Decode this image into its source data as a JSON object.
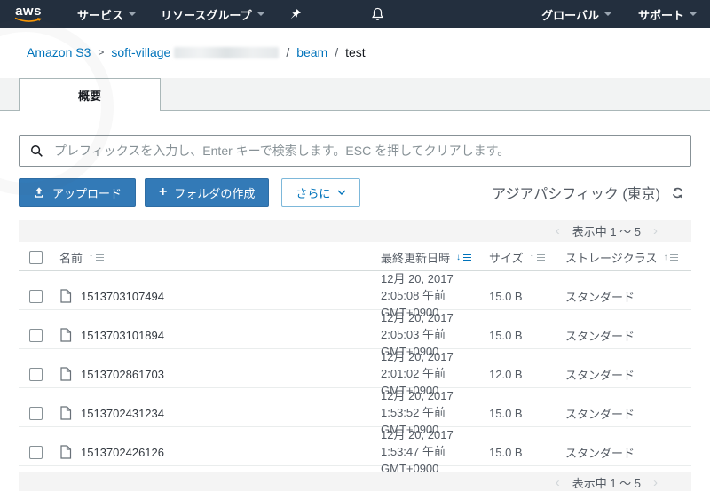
{
  "colors": {
    "nav_bg": "#232f3e",
    "accent_blue": "#0073bb",
    "button_blue": "#337ab7",
    "logo_orange": "#ff9900"
  },
  "topnav": {
    "logo_text": "aws",
    "services_label": "サービス",
    "resource_groups_label": "リソースグループ",
    "global_label": "グローバル",
    "support_label": "サポート"
  },
  "breadcrumb": {
    "root": "Amazon S3",
    "root_separator": ">",
    "bucket_visible": "soft-village",
    "path_separator": "/",
    "folder": "beam",
    "current": "test"
  },
  "tabs": {
    "overview_label": "概要"
  },
  "search": {
    "placeholder": "プレフィックスを入力し、Enter キーで検索します。ESC を押してクリアします。"
  },
  "toolbar": {
    "upload_label": "アップロード",
    "create_folder_label": "フォルダの作成",
    "more_label": "さらに",
    "region_label": "アジアパシフィック (東京)"
  },
  "table": {
    "pagination_label": "表示中 1 ～ 5",
    "columns": [
      {
        "label": "名前",
        "sort_active": false,
        "sort_dir": "asc"
      },
      {
        "label": "最終更新日時",
        "sort_active": true,
        "sort_dir": "desc"
      },
      {
        "label": "サイズ",
        "sort_active": false,
        "sort_dir": "asc"
      },
      {
        "label": "ストレージクラス",
        "sort_active": false,
        "sort_dir": "asc"
      }
    ],
    "rows": [
      {
        "name": "1513703107494",
        "modified": "12月 20, 2017 2:05:08 午前 GMT+0900",
        "size": "15.0 B",
        "storage_class": "スタンダード"
      },
      {
        "name": "1513703101894",
        "modified": "12月 20, 2017 2:05:03 午前 GMT+0900",
        "size": "15.0 B",
        "storage_class": "スタンダード"
      },
      {
        "name": "1513702861703",
        "modified": "12月 20, 2017 2:01:02 午前 GMT+0900",
        "size": "12.0 B",
        "storage_class": "スタンダード"
      },
      {
        "name": "1513702431234",
        "modified": "12月 20, 2017 1:53:52 午前 GMT+0900",
        "size": "15.0 B",
        "storage_class": "スタンダード"
      },
      {
        "name": "1513702426126",
        "modified": "12月 20, 2017 1:53:47 午前 GMT+0900",
        "size": "15.0 B",
        "storage_class": "スタンダード"
      }
    ]
  }
}
